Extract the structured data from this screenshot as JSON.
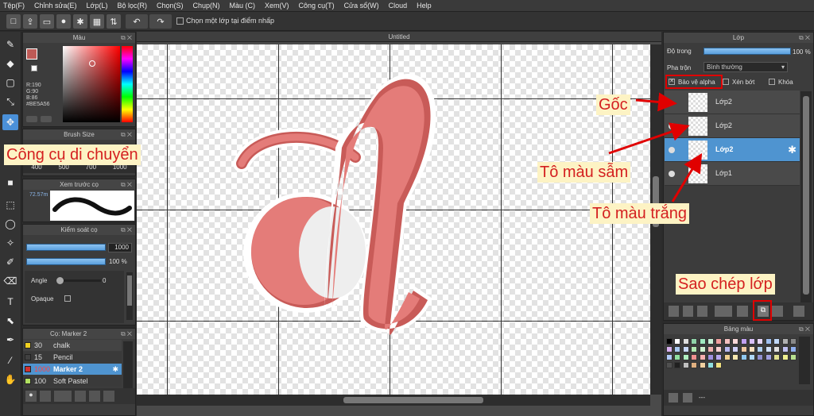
{
  "menu": [
    "Tệp(F)",
    "Chỉnh sửa(E)",
    "Lớp(L)",
    "Bộ lọc(R)",
    "Chọn(S)",
    "Chụp(N)",
    "Màu (C)",
    "Xem(V)",
    "Công cụ(T)",
    "Cửa sổ(W)",
    "Cloud",
    "Help"
  ],
  "toolbar": {
    "reference_label": "Chọn một lớp tại điểm nhấp"
  },
  "color_panel": {
    "title": "Màu",
    "r": "R:190",
    "g": "G:90",
    "b": "B:86",
    "hex": "#BE5A56",
    "fg": "#BE5A56"
  },
  "brush_size": {
    "title": "Brush Size",
    "values": [
      "400",
      "500",
      "700",
      "1000"
    ],
    "callout": "Công cụ di chuyển"
  },
  "preview": {
    "title": "Xem trước cọ",
    "size": "72.57m"
  },
  "brush_control": {
    "title": "Kiểm soát cọ",
    "size_value": "1000",
    "opacity_value": "100 %",
    "angle_label": "Angle",
    "angle_value": "0",
    "opaque_label": "Opaque"
  },
  "brush_list": {
    "title": "Cọ: Marker 2",
    "items": [
      {
        "num": "30",
        "name": "chalk",
        "color": "#f0d020"
      },
      {
        "num": "15",
        "name": "Pencil",
        "color": "#404040"
      },
      {
        "num": "1000",
        "name": "Marker 2",
        "color": "#d03030",
        "selected": true
      },
      {
        "num": "100",
        "name": "Soft Pastel",
        "color": "#b0e060"
      }
    ]
  },
  "document": {
    "title": "Untitled"
  },
  "layer_panel": {
    "title": "Lớp",
    "opacity_label": "Độ trong",
    "opacity_value": "100 %",
    "blend_label": "Pha trộn",
    "blend_value": "Bình thường",
    "protect_alpha": "Bảo vệ alpha",
    "clipping": "Xén bớt",
    "lock": "Khóa",
    "layers": [
      {
        "name": "Lớp2",
        "selected": false
      },
      {
        "name": "Lớp2",
        "selected": false
      },
      {
        "name": "Lớp2",
        "selected": true
      },
      {
        "name": "Lớp1",
        "selected": false
      }
    ]
  },
  "callouts": {
    "goc": "Gốc",
    "dark": "Tô màu sẫm",
    "white": "Tô màu trắng",
    "duplicate": "Sao chép lớp"
  },
  "palette": {
    "title": "Bảng màu",
    "footer": "---"
  }
}
